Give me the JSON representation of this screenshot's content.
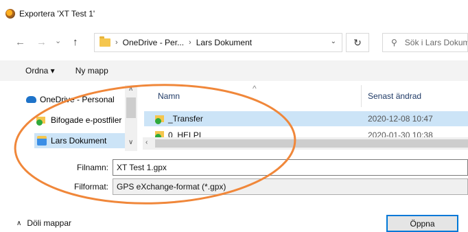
{
  "window": {
    "title": "Exportera 'XT Test 1'",
    "app_icon": "app-globe-icon"
  },
  "navigation": {
    "back_icon": "←",
    "forward_icon": "→",
    "recent_icon": "⌄",
    "up_icon": "↑"
  },
  "address_bar": {
    "breadcrumbs": [
      "OneDrive - Per...",
      "Lars Dokument"
    ],
    "separator": "›",
    "dropdown_icon": "⌄",
    "refresh_icon": "↻"
  },
  "search": {
    "placeholder": "Sök i Lars Dokument",
    "icon": "⚲"
  },
  "toolbar": {
    "organize_label": "Ordna ▾",
    "new_folder_label": "Ny mapp"
  },
  "nav_pane": {
    "items": [
      {
        "label": "OneDrive - Personal",
        "icon": "onedrive-cloud-icon"
      },
      {
        "label": "Bifogade e-postfiler",
        "icon": "synced-folder-icon"
      },
      {
        "label": "Lars Dokument",
        "icon": "documents-icon",
        "selected": true
      }
    ]
  },
  "file_list": {
    "columns": {
      "name": "Namn",
      "date_modified": "Senast ändrad"
    },
    "rows": [
      {
        "name": "_Transfer",
        "date": "2020-12-08 10:47",
        "selected": true
      },
      {
        "name": "0_HELPI",
        "date": "2020-01-30 10:38",
        "selected": false
      }
    ]
  },
  "form": {
    "filename_label": "Filnamn:",
    "filename_value": "XT Test 1.gpx",
    "format_label": "Filformat:",
    "format_value": "GPS eXchange-format (*.gpx)"
  },
  "footer": {
    "hide_folders_label": "Döli mappar",
    "hide_folders_icon": "∧",
    "open_button_label": "Öppna"
  },
  "colors": {
    "selection": "#cce4f7",
    "accent": "#0078d7",
    "annotation": "#f0873a"
  }
}
